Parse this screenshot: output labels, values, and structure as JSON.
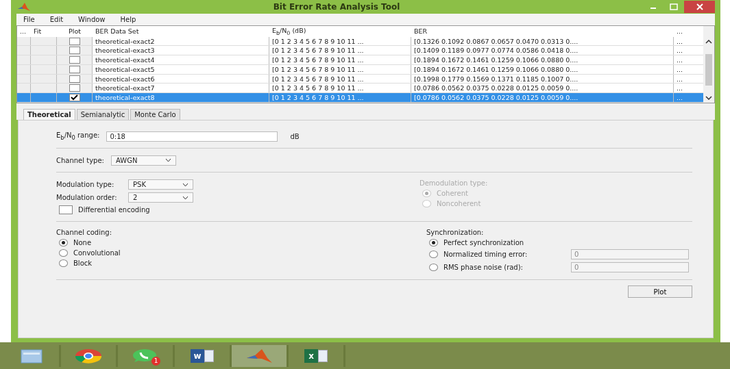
{
  "window": {
    "title": "Bit Error Rate Analysis Tool"
  },
  "menu": [
    "File",
    "Edit",
    "Window",
    "Help"
  ],
  "table": {
    "columns": [
      "...",
      "Fit",
      "Plot",
      "BER Data Set",
      "E$_{b}$/N$_{0}$ (dB)",
      "BER",
      "..."
    ],
    "rows": [
      {
        "plot": false,
        "selected": false,
        "name": "theoretical-exact2",
        "ebno": "[0 1 2 3 4 5 6 7 8 9 10 11 ...",
        "ber": "[0.1326  0.1092  0.0867  0.0657  0.0470  0.0313  0....",
        "more": "..."
      },
      {
        "plot": false,
        "selected": false,
        "name": "theoretical-exact3",
        "ebno": "[0 1 2 3 4 5 6 7 8 9 10 11 ...",
        "ber": "[0.1409  0.1189  0.0977  0.0774  0.0586  0.0418  0....",
        "more": "..."
      },
      {
        "plot": false,
        "selected": false,
        "name": "theoretical-exact4",
        "ebno": "[0 1 2 3 4 5 6 7 8 9 10 11 ...",
        "ber": "[0.1894  0.1672  0.1461  0.1259  0.1066  0.0880  0....",
        "more": "..."
      },
      {
        "plot": false,
        "selected": false,
        "name": "theoretical-exact5",
        "ebno": "[0 1 2 3 4 5 6 7 8 9 10 11 ...",
        "ber": "[0.1894  0.1672  0.1461  0.1259  0.1066  0.0880  0....",
        "more": "..."
      },
      {
        "plot": false,
        "selected": false,
        "name": "theoretical-exact6",
        "ebno": "[0 1 2 3 4 5 6 7 8 9 10 11 ...",
        "ber": "[0.1998  0.1779  0.1569  0.1371  0.1185  0.1007  0....",
        "more": "..."
      },
      {
        "plot": false,
        "selected": false,
        "name": "theoretical-exact7",
        "ebno": "[0 1 2 3 4 5 6 7 8 9 10 11 ...",
        "ber": "[0.0786  0.0562  0.0375  0.0228  0.0125  0.0059  0....",
        "more": "..."
      },
      {
        "plot": true,
        "selected": true,
        "name": "theoretical-exact8",
        "ebno": "[0 1 2 3 4 5 6 7 8 9 10 11 ...",
        "ber": "[0.0786  0.0562  0.0375  0.0228  0.0125  0.0059  0....",
        "more": "..."
      }
    ]
  },
  "tabs": [
    {
      "label": "Theoretical",
      "selected": true
    },
    {
      "label": "Semianalytic",
      "selected": false
    },
    {
      "label": "Monte Carlo",
      "selected": false
    }
  ],
  "range": {
    "label": "E$_{b}$/N$_{0}$ range:",
    "value": "0:18",
    "unit": "dB"
  },
  "channel_type": {
    "label": "Channel type:",
    "value": "AWGN"
  },
  "modulation_type": {
    "label": "Modulation type:",
    "value": "PSK"
  },
  "modulation_order": {
    "label": "Modulation order:",
    "value": "2"
  },
  "differential": {
    "label": "Differential encoding",
    "checked": false
  },
  "demodulation": {
    "label": "Demodulation type:",
    "disabled": true,
    "options": [
      {
        "label": "Coherent",
        "selected": true
      },
      {
        "label": "Noncoherent",
        "selected": false
      }
    ]
  },
  "coding": {
    "label": "Channel coding:",
    "options": [
      {
        "label": "None",
        "selected": true
      },
      {
        "label": "Convolutional",
        "selected": false
      },
      {
        "label": "Block",
        "selected": false
      }
    ]
  },
  "sync": {
    "label": "Synchronization:",
    "options": [
      {
        "label": "Perfect synchronization",
        "selected": true
      },
      {
        "label": "Normalized timing error:",
        "selected": false,
        "value": "0"
      },
      {
        "label": "RMS phase noise (rad):",
        "selected": false,
        "value": "0"
      }
    ]
  },
  "plot_button": "Plot",
  "taskbar": [
    {
      "kind": "files",
      "active": false
    },
    {
      "kind": "browser",
      "active": false
    },
    {
      "kind": "chat",
      "active": false,
      "badge": "1"
    },
    {
      "kind": "word",
      "active": false,
      "glyph": "w"
    },
    {
      "kind": "matlab",
      "active": true
    },
    {
      "kind": "excel",
      "active": false,
      "glyph": "x"
    }
  ]
}
